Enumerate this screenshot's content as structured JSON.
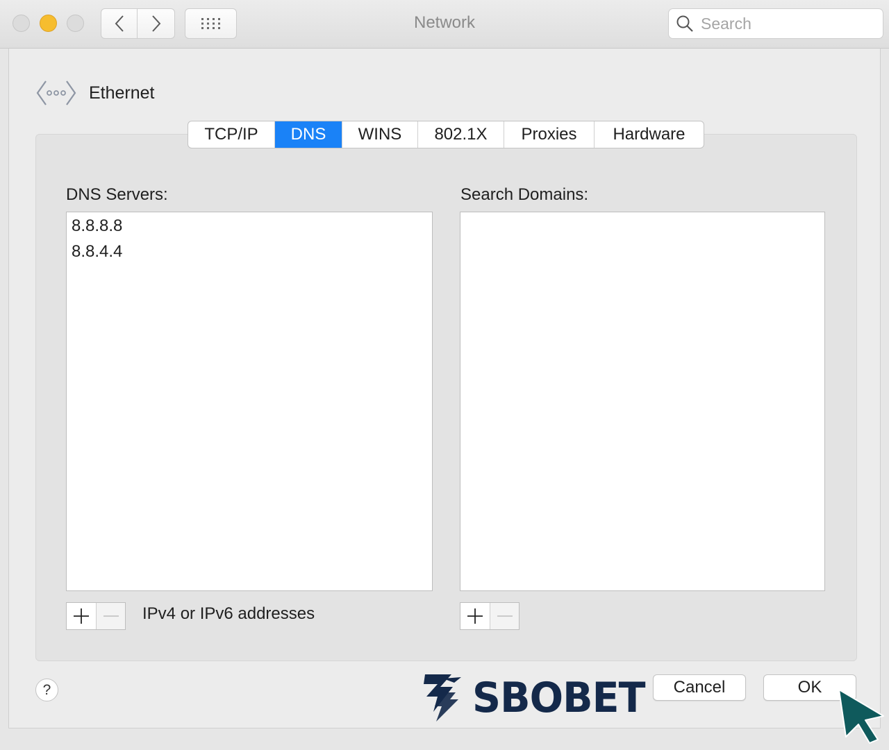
{
  "window": {
    "title": "Network"
  },
  "toolbar": {
    "search_placeholder": "Search",
    "icons": [
      "back-chevron-icon",
      "forward-chevron-icon",
      "grid-icon",
      "search-icon"
    ]
  },
  "interface": {
    "name": "Ethernet",
    "icon": "ethernet-icon"
  },
  "tabs": [
    {
      "label": "TCP/IP",
      "active": false
    },
    {
      "label": "DNS",
      "active": true
    },
    {
      "label": "WINS",
      "active": false
    },
    {
      "label": "802.1X",
      "active": false
    },
    {
      "label": "Proxies",
      "active": false
    },
    {
      "label": "Hardware",
      "active": false
    }
  ],
  "dns": {
    "label": "DNS Servers:",
    "servers": [
      "8.8.8.8",
      "8.8.4.4"
    ],
    "hint": "IPv4 or IPv6 addresses"
  },
  "search_domains": {
    "label": "Search Domains:",
    "entries": []
  },
  "footer": {
    "help_label": "?",
    "cancel_label": "Cancel",
    "ok_label": "OK"
  },
  "watermark": {
    "text": "SBOBET"
  },
  "colors": {
    "accent": "#1a82f7",
    "cursor": "#0f5a5c",
    "logo": "#14294a"
  }
}
